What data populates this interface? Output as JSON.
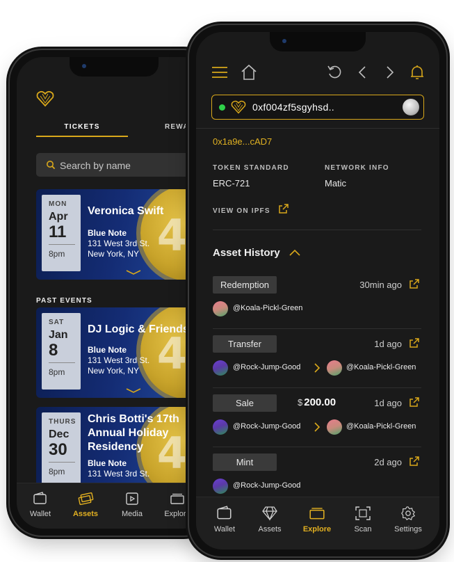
{
  "colors": {
    "accent": "#d9a81b",
    "online": "#2fd14a",
    "background": "#1a1a1a"
  },
  "back_phone": {
    "logo_icon": "heart-gem-icon",
    "tabs": [
      {
        "label": "TICKETS",
        "active": true
      },
      {
        "label": "REWARDS",
        "active": false
      }
    ],
    "search": {
      "placeholder": "Search by name",
      "icon": "search-icon"
    },
    "events": [
      {
        "dow": "MON",
        "month": "Apr",
        "day": "11",
        "time": "8pm",
        "title": "Veronica Swift",
        "venue": "Blue Note",
        "address1": "131 West 3rd St.",
        "address2": "New York, NY",
        "badge": "40"
      }
    ],
    "past_label": "PAST EVENTS",
    "past_events": [
      {
        "dow": "SAT",
        "month": "Jan",
        "day": "8",
        "time": "8pm",
        "title": "DJ Logic & Friends",
        "venue": "Blue Note",
        "address1": "131 West 3rd St.",
        "address2": "New York, NY",
        "badge": "40"
      },
      {
        "dow": "THURS",
        "month": "Dec",
        "day": "30",
        "time": "8pm",
        "title": "Chris Botti's 17th Annual Holiday Residency",
        "venue": "Blue Note",
        "address1": "131 West 3rd St.",
        "address2": "",
        "badge": "40"
      }
    ],
    "nav": [
      {
        "label": "Wallet",
        "icon": "wallet-icon",
        "active": false
      },
      {
        "label": "Assets",
        "icon": "tickets-icon",
        "active": true
      },
      {
        "label": "Media",
        "icon": "media-icon",
        "active": false
      },
      {
        "label": "Explore",
        "icon": "explore-icon",
        "active": false
      }
    ]
  },
  "front_phone": {
    "topbar_icons": [
      "menu-icon",
      "home-icon",
      "refresh-icon",
      "back-icon",
      "forward-icon",
      "bell-icon"
    ],
    "wallet": {
      "address": "0xf004zf5sgyhsd..",
      "status": "online"
    },
    "contract_address": "0x1a9e...cAD7",
    "token_standard": {
      "label": "TOKEN STANDARD",
      "value": "ERC-721"
    },
    "network_info": {
      "label": "NETWORK INFO",
      "value": "Matic"
    },
    "ipfs_label": "VIEW ON IPFS",
    "history_title": "Asset History",
    "history": [
      {
        "type": "Redemption",
        "time": "30min ago",
        "price": "",
        "currency": "",
        "from": "@Koala-Pickl-Green",
        "to": ""
      },
      {
        "type": "Transfer",
        "time": "1d ago",
        "price": "",
        "currency": "",
        "from": "@Rock-Jump-Good",
        "to": "@Koala-Pickl-Green"
      },
      {
        "type": "Sale",
        "time": "1d ago",
        "price": "200.00",
        "currency": "$",
        "from": "@Rock-Jump-Good",
        "to": "@Koala-Pickl-Green"
      },
      {
        "type": "Mint",
        "time": "2d ago",
        "price": "",
        "currency": "",
        "from": "@Rock-Jump-Good",
        "to": ""
      }
    ],
    "nav": [
      {
        "label": "Wallet",
        "icon": "wallet-icon",
        "active": false
      },
      {
        "label": "Assets",
        "icon": "diamond-icon",
        "active": false
      },
      {
        "label": "Explore",
        "icon": "explore-icon",
        "active": true
      },
      {
        "label": "Scan",
        "icon": "scan-icon",
        "active": false
      },
      {
        "label": "Settings",
        "icon": "gear-icon",
        "active": false
      }
    ]
  }
}
